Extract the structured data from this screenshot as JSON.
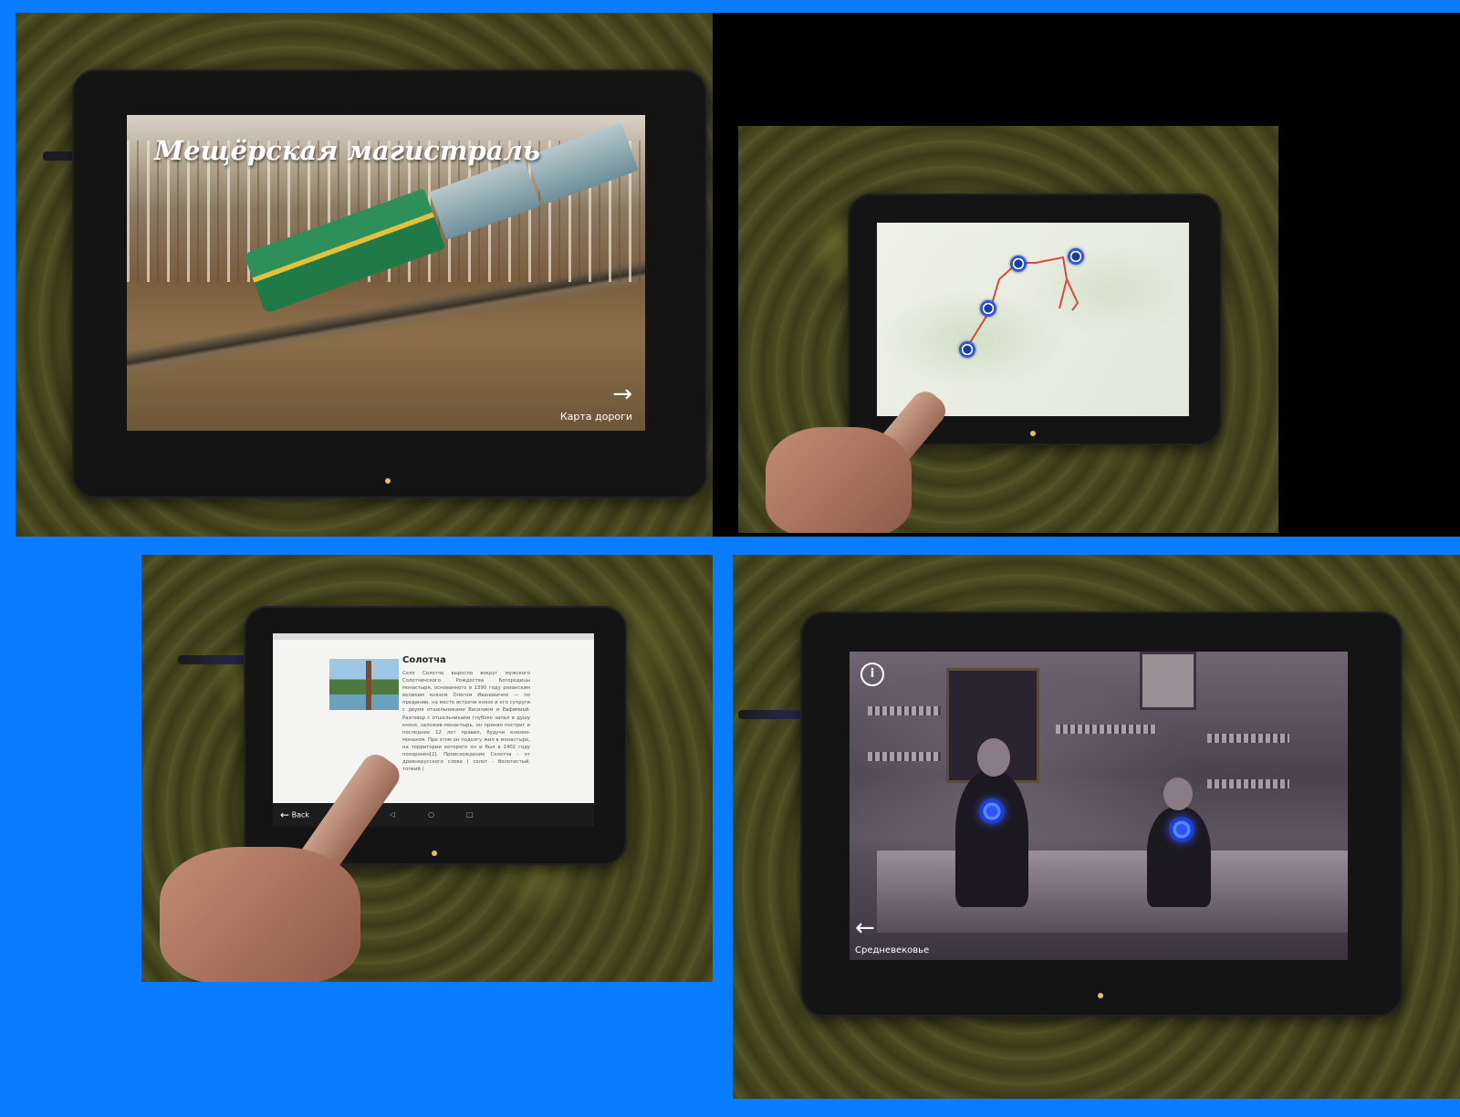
{
  "panel_title": {
    "heading": "Мещёрская магистраль",
    "next_arrow": "→",
    "next_label": "Карта дороги"
  },
  "panel_map": {
    "pins": 4
  },
  "panel_article": {
    "title": "Солотча",
    "body": "Село Солотча выросло вокруг мужского Солотчинского Рождества Богородицы монастыря, основанного в 1390 году рязанским великим князем Олегом Ивановичем — по преданию, на месте встречи князя и его супруги с двумя отшельниками Василием и Евфимией. Разговор с отшельниками глубоко запал в душу князя, заложив монастырь, он принял постриг и последние 12 лет правил, будучи князем-монахом. При этом он подолгу жил в монастыре, на территории которого он и был в 1402 году похоронен[2]. Происхождение Солотча - от древнерусского слова ( солот - болотистый, топкий )",
    "back_arrow": "←",
    "back_label": "Back",
    "nav_back": "◁",
    "nav_home": "○",
    "nav_recent": "□"
  },
  "panel_archive": {
    "info_icon": "i",
    "prev_arrow": "←",
    "prev_label": "Средневековье"
  },
  "colors": {
    "frame_blue": "#0a7cff",
    "hotspot_blue": "#2a56ff",
    "route_red": "#e0463a"
  }
}
